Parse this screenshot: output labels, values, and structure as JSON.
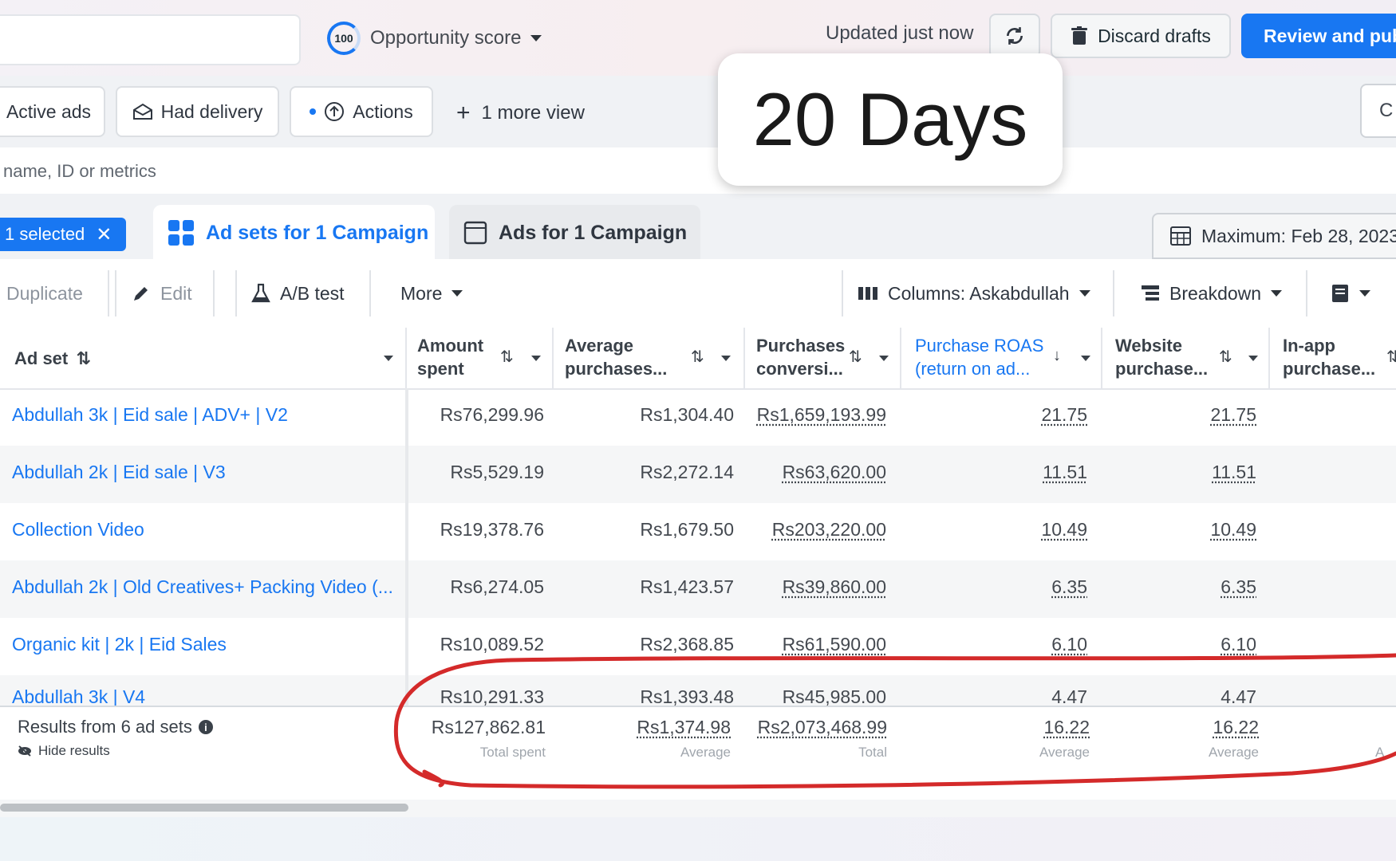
{
  "topbar": {
    "opportunity_score_value": "100",
    "opportunity_score_label": "Opportunity score",
    "updated_text": "Updated just now",
    "discard_label": "Discard drafts",
    "review_label": "Review and publ"
  },
  "filters": {
    "active_ads": "Active ads",
    "had_delivery": "Had delivery",
    "actions": "Actions",
    "more_view": "1 more view",
    "right_chip": "C"
  },
  "search": {
    "placeholder": "name, ID or metrics"
  },
  "overlay": {
    "days": "20 Days"
  },
  "tabs": {
    "selected": "1 selected",
    "ad_sets": "Ad sets for 1 Campaign",
    "ads": "Ads for 1 Campaign",
    "date_range": "Maximum: Feb 28, 2023"
  },
  "toolbar": {
    "duplicate": "Duplicate",
    "edit": "Edit",
    "ab_test": "A/B test",
    "more": "More",
    "columns": "Columns: Askabdullah",
    "breakdown": "Breakdown"
  },
  "table": {
    "headers": {
      "ad_set": "Ad set",
      "amount_spent_1": "Amount",
      "amount_spent_2": "spent",
      "avg_purchases_1": "Average",
      "avg_purchases_2": "purchases...",
      "purchases_conv_1": "Purchases",
      "purchases_conv_2": "conversi...",
      "roas_1": "Purchase ROAS",
      "roas_2": "(return on ad...",
      "website_1": "Website",
      "website_2": "purchase...",
      "inapp_1": "In-app",
      "inapp_2": "purchase..."
    },
    "rows": [
      {
        "name": "Abdullah 3k | Eid sale | ADV+ | V2",
        "spent": "Rs76,299.96",
        "avg": "Rs1,304.40",
        "conv": "Rs1,659,193.99",
        "roas": "21.75",
        "web": "21.75"
      },
      {
        "name": "Abdullah 2k | Eid sale | V3",
        "spent": "Rs5,529.19",
        "avg": "Rs2,272.14",
        "conv": "Rs63,620.00",
        "roas": "11.51",
        "web": "11.51"
      },
      {
        "name": "Collection Video",
        "spent": "Rs19,378.76",
        "avg": "Rs1,679.50",
        "conv": "Rs203,220.00",
        "roas": "10.49",
        "web": "10.49"
      },
      {
        "name": "Abdullah 2k | Old Creatives+ Packing Video (...",
        "spent": "Rs6,274.05",
        "avg": "Rs1,423.57",
        "conv": "Rs39,860.00",
        "roas": "6.35",
        "web": "6.35"
      },
      {
        "name": "Organic kit | 2k | Eid Sales",
        "spent": "Rs10,089.52",
        "avg": "Rs2,368.85",
        "conv": "Rs61,590.00",
        "roas": "6.10",
        "web": "6.10"
      },
      {
        "name": "Abdullah 3k | V4",
        "spent": "Rs10,291.33",
        "avg": "Rs1,393.48",
        "conv": "Rs45,985.00",
        "roas": "4.47",
        "web": "4.47"
      }
    ],
    "totals": {
      "label": "Results from 6 ad sets",
      "hide": "Hide results",
      "spent": "Rs127,862.81",
      "spent_sub": "Total spent",
      "avg": "Rs1,374.98",
      "avg_sub": "Average",
      "conv": "Rs2,073,468.99",
      "conv_sub": "Total",
      "roas": "16.22",
      "roas_sub": "Average",
      "web": "16.22",
      "web_sub": "Average",
      "inapp_sub": "A"
    }
  },
  "colors": {
    "accent": "#1877f2",
    "annotation": "#d42a2a"
  }
}
